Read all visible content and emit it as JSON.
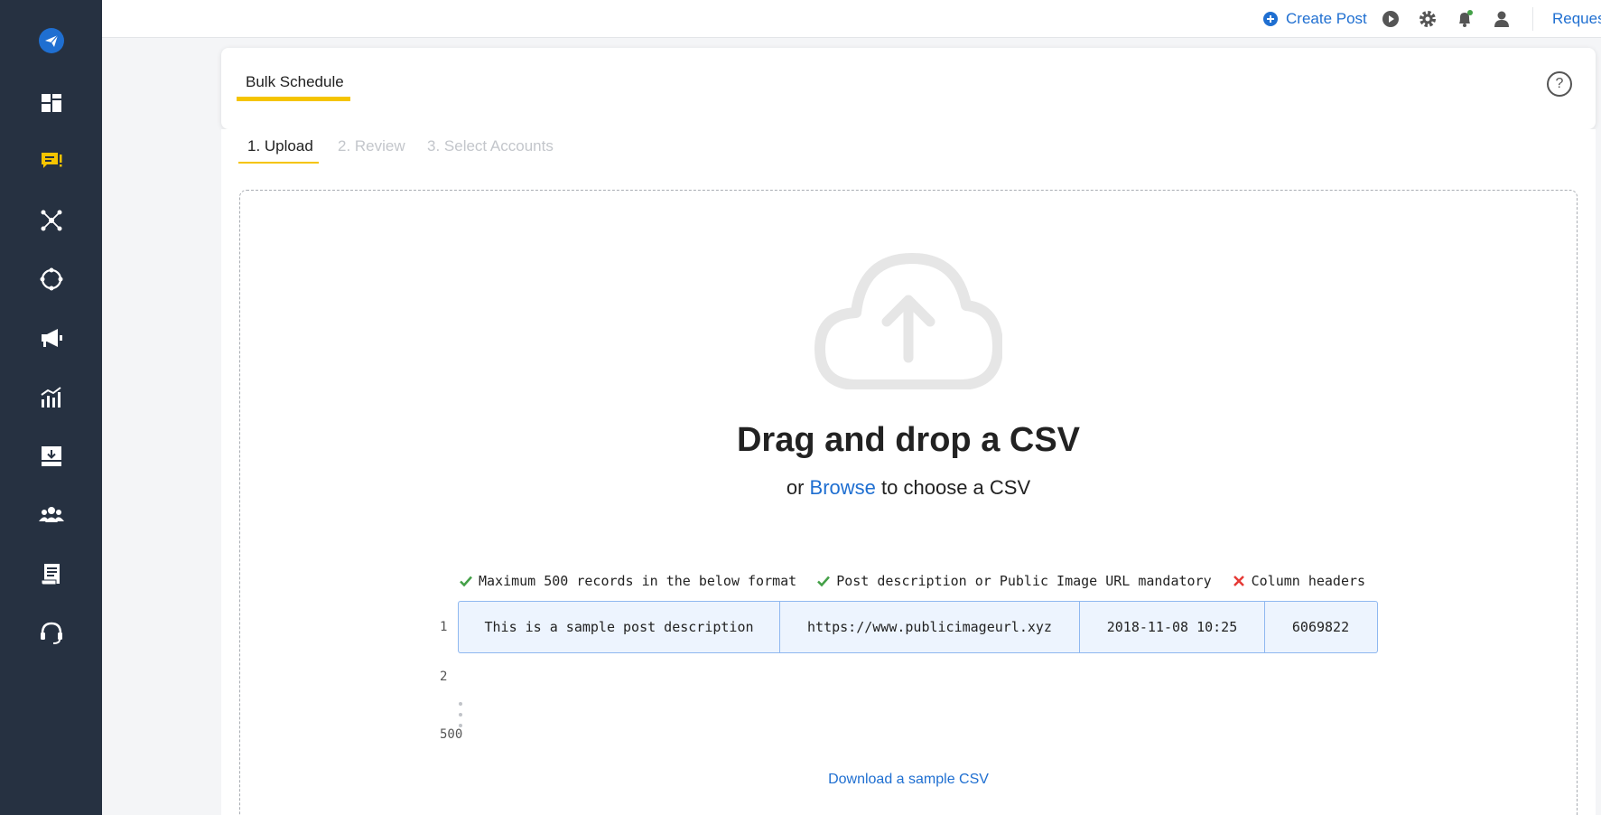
{
  "sidebar": {
    "items": [
      {
        "icon": "paper-plane-logo-icon"
      },
      {
        "icon": "dashboard-icon"
      },
      {
        "icon": "publish-chat-icon",
        "color": "#f5c400"
      },
      {
        "icon": "network-icon"
      },
      {
        "icon": "engagement-circle-icon"
      },
      {
        "icon": "megaphone-icon"
      },
      {
        "icon": "analytics-icon"
      },
      {
        "icon": "inbox-download-icon"
      },
      {
        "icon": "team-icon"
      },
      {
        "icon": "report-icon"
      },
      {
        "icon": "support-headset-icon"
      }
    ]
  },
  "topbar": {
    "create_post_label": "Create Post",
    "request_label": "Reques",
    "icons": [
      "play-icon",
      "settings-gear-icon",
      "notification-bell-icon",
      "user-profile-icon"
    ]
  },
  "header": {
    "tab_label": "Bulk Schedule",
    "help_label": "?"
  },
  "steps": [
    {
      "label": "1. Upload",
      "active": true
    },
    {
      "label": "2. Review",
      "active": false
    },
    {
      "label": "3. Select Accounts",
      "active": false
    }
  ],
  "dropzone": {
    "title": "Drag and drop a CSV",
    "browse_prefix": "or",
    "browse_link": "Browse",
    "browse_suffix": "to choose a CSV",
    "rules": [
      {
        "ok": true,
        "text": "Maximum 500 records in the below format"
      },
      {
        "ok": true,
        "text": "Post description or Public Image URL mandatory"
      },
      {
        "ok": false,
        "text": "Column headers"
      }
    ],
    "row_numbers": [
      "1",
      "2",
      "500"
    ],
    "sample_row": [
      "This is a sample post description",
      "https://www.publicimageurl.xyz",
      "2018-11-08 10:25",
      "6069822"
    ],
    "download_label": "Download a sample CSV"
  },
  "colors": {
    "sidebar_bg": "#263141",
    "accent_yellow": "#f5c400",
    "link_blue": "#1f6fd1",
    "check_green": "#43a047",
    "cross_red": "#e53935"
  }
}
